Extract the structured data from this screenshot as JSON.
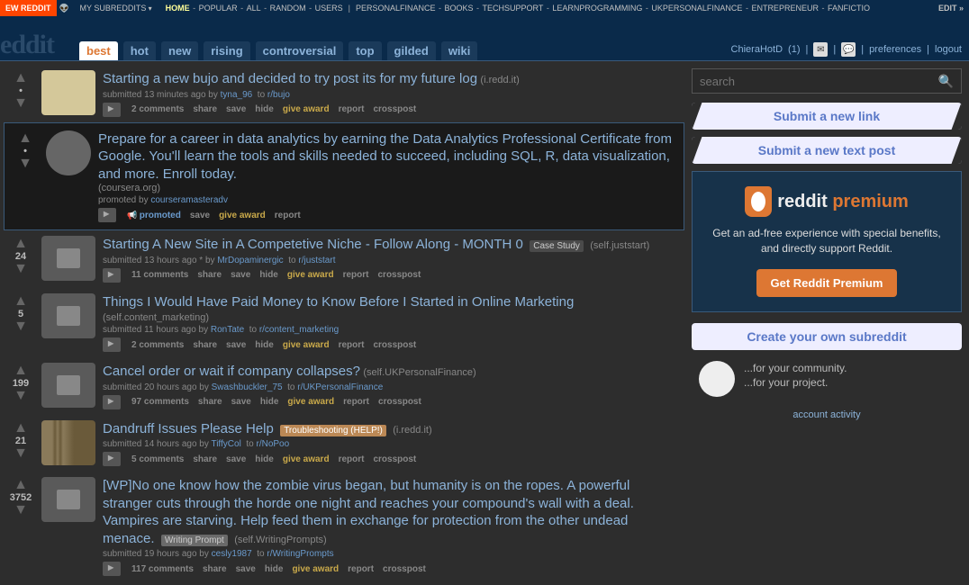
{
  "topbar": {
    "newreddit": "EW REDDIT",
    "mysubs": "MY SUBREDDITS",
    "edit": "EDIT »",
    "links": [
      "HOME",
      "POPULAR",
      "ALL",
      "RANDOM",
      "USERS",
      "PERSONALFINANCE",
      "BOOKS",
      "TECHSUPPORT",
      "LEARNPROGRAMMING",
      "UKPERSONALFINANCE",
      "ENTREPRENEUR",
      "FANFICTIO"
    ]
  },
  "header": {
    "logo": "eddit",
    "tabs": [
      "best",
      "hot",
      "new",
      "rising",
      "controversial",
      "top",
      "gilded",
      "wiki"
    ],
    "user": "ChieraHotD",
    "karma": "1",
    "prefs": "preferences",
    "logout": "logout"
  },
  "search": {
    "placeholder": "search"
  },
  "side": {
    "submit_link": "Submit a new link",
    "submit_text": "Submit a new text post",
    "premium_title_r": "reddit",
    "premium_title_p": " premium",
    "premium_sub": "Get an ad-free experience with special benefits, and directly support Reddit.",
    "premium_btn": "Get Reddit Premium",
    "create": "Create your own subreddit",
    "for1": "...for your community.",
    "for2": "...for your project.",
    "acct": "account activity"
  },
  "posts": [
    {
      "score": "•",
      "thumb": "img",
      "title": "Starting a new bujo and decided to try post its for my future log",
      "domain": "(i.redd.it)",
      "meta_time": "submitted 13 minutes ago by ",
      "author": "tyna_96",
      "to": "to ",
      "sub": "r/bujo",
      "comments": "2 comments"
    },
    {
      "promoted": true,
      "score": "•",
      "thumb": "link",
      "title": "Prepare for a career in data analytics by earning the Data Analytics Professional Certificate from Google. You'll learn the tools and skills needed to succeed, including SQL, R, data visualization, and more. Enroll today.",
      "domain": "(coursera.org)",
      "meta_time": "promoted by ",
      "author": "courseramasteradv",
      "promolabel": "promoted"
    },
    {
      "score": "24",
      "thumb": "text",
      "title": "Starting A New Site in A Competetive Niche - Follow Along - MONTH 0",
      "flair": "Case Study",
      "domain": "(self.juststart)",
      "meta_time": "submitted 13 hours ago * by ",
      "author": "MrDopaminergic",
      "to": "to ",
      "sub": "r/juststart",
      "comments": "11 comments"
    },
    {
      "score": "5",
      "thumb": "text",
      "title": "Things I Would Have Paid Money to Know Before I Started in Online Marketing",
      "domain": "(self.content_marketing)",
      "meta_time": "submitted 11 hours ago by ",
      "author": "RonTate",
      "to": "to ",
      "sub": "r/content_marketing",
      "comments": "2 comments"
    },
    {
      "score": "199",
      "thumb": "text",
      "title": "Cancel order or wait if company collapses?",
      "domain": "(self.UKPersonalFinance)",
      "meta_time": "submitted 20 hours ago by ",
      "author": "Swashbuckler_75",
      "to": "to ",
      "sub": "r/UKPersonalFinance",
      "comments": "97 comments"
    },
    {
      "score": "21",
      "thumb": "hair",
      "title": "Dandruff Issues Please Help",
      "flair": "Troubleshooting (HELP!)",
      "flair_red": true,
      "domain": "(i.redd.it)",
      "meta_time": "submitted 14 hours ago by ",
      "author": "TiffyCol",
      "to": "to ",
      "sub": "r/NoPoo",
      "comments": "5 comments"
    },
    {
      "score": "3752",
      "thumb": "text",
      "title": "[WP]No one know how the zombie virus began, but humanity is on the ropes. A powerful stranger cuts through the horde one night and reaches your compound's wall with a deal. Vampires are starving. Help feed them in exchange for protection from the other undead menace.",
      "flair": "Writing Prompt",
      "flair_wp": true,
      "domain": "(self.WritingPrompts)",
      "meta_time": "submitted 19 hours ago by ",
      "author": "cesly1987",
      "to": "to ",
      "sub": "r/WritingPrompts",
      "comments": "117 comments"
    }
  ],
  "act": {
    "share": "share",
    "save": "save",
    "hide": "hide",
    "award": "give award",
    "report": "report",
    "cross": "crosspost"
  }
}
